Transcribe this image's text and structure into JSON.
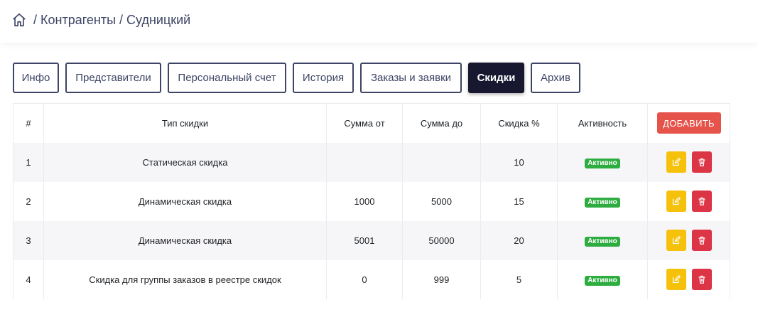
{
  "breadcrumb": {
    "home_icon": "home-icon",
    "separator": "/",
    "items": [
      "Контрагенты",
      "Судницкий"
    ]
  },
  "tabs": [
    {
      "label": "Инфо",
      "active": false
    },
    {
      "label": "Представители",
      "active": false
    },
    {
      "label": "Персональный счет",
      "active": false
    },
    {
      "label": "История",
      "active": false
    },
    {
      "label": "Заказы и заявки",
      "active": false
    },
    {
      "label": "Скидки",
      "active": true
    },
    {
      "label": "Архив",
      "active": false
    }
  ],
  "table": {
    "headers": {
      "num": "#",
      "type": "Тип скидки",
      "sum_from": "Сумма от",
      "sum_to": "Сумма до",
      "discount": "Скидка %",
      "activity": "Активность"
    },
    "add_button": "ДОБАВИТЬ",
    "rows": [
      {
        "num": "1",
        "type": "Статическая скидка",
        "sum_from": "",
        "sum_to": "",
        "discount": "10",
        "status": "Активно"
      },
      {
        "num": "2",
        "type": "Динамическая скидка",
        "sum_from": "1000",
        "sum_to": "5000",
        "discount": "15",
        "status": "Активно"
      },
      {
        "num": "3",
        "type": "Динамическая скидка",
        "sum_from": "5001",
        "sum_to": "50000",
        "discount": "20",
        "status": "Активно"
      },
      {
        "num": "4",
        "type": "Скидка для группы заказов в реестре скидок",
        "sum_from": "0",
        "sum_to": "999",
        "discount": "5",
        "status": "Активно"
      }
    ],
    "row_actions": {
      "edit_icon": "edit-icon",
      "delete_icon": "trash-icon"
    }
  },
  "colors": {
    "accent_dark": "#17182f",
    "text_primary": "#3d4465",
    "add_button": "#e5534b",
    "badge_active": "#2dac3f",
    "edit": "#f5c10b",
    "delete": "#dc3545"
  }
}
